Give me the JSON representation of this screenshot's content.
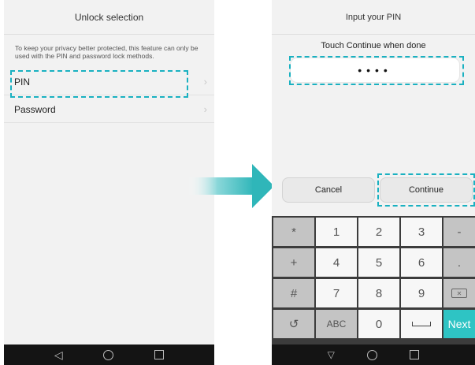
{
  "left_screen": {
    "title": "Unlock selection",
    "description": "To keep your privacy better protected, this feature can only be used with the PIN and password lock methods.",
    "items": [
      {
        "label": "PIN"
      },
      {
        "label": "Password"
      }
    ]
  },
  "right_screen": {
    "title": "Input your PIN",
    "hint": "Touch Continue when done",
    "pin_value": "••••",
    "cancel_label": "Cancel",
    "continue_label": "Continue"
  },
  "keypad": {
    "rows": [
      [
        "*",
        "1",
        "2",
        "3",
        "-"
      ],
      [
        "+",
        "4",
        "5",
        "6",
        "."
      ],
      [
        "#",
        "7",
        "8",
        "9",
        "⌫"
      ],
      [
        "↺",
        "ABC",
        "0",
        "space",
        "Next"
      ]
    ]
  },
  "colors": {
    "highlight_dash": "#1ab1c1",
    "next_key": "#2ec4c4"
  }
}
